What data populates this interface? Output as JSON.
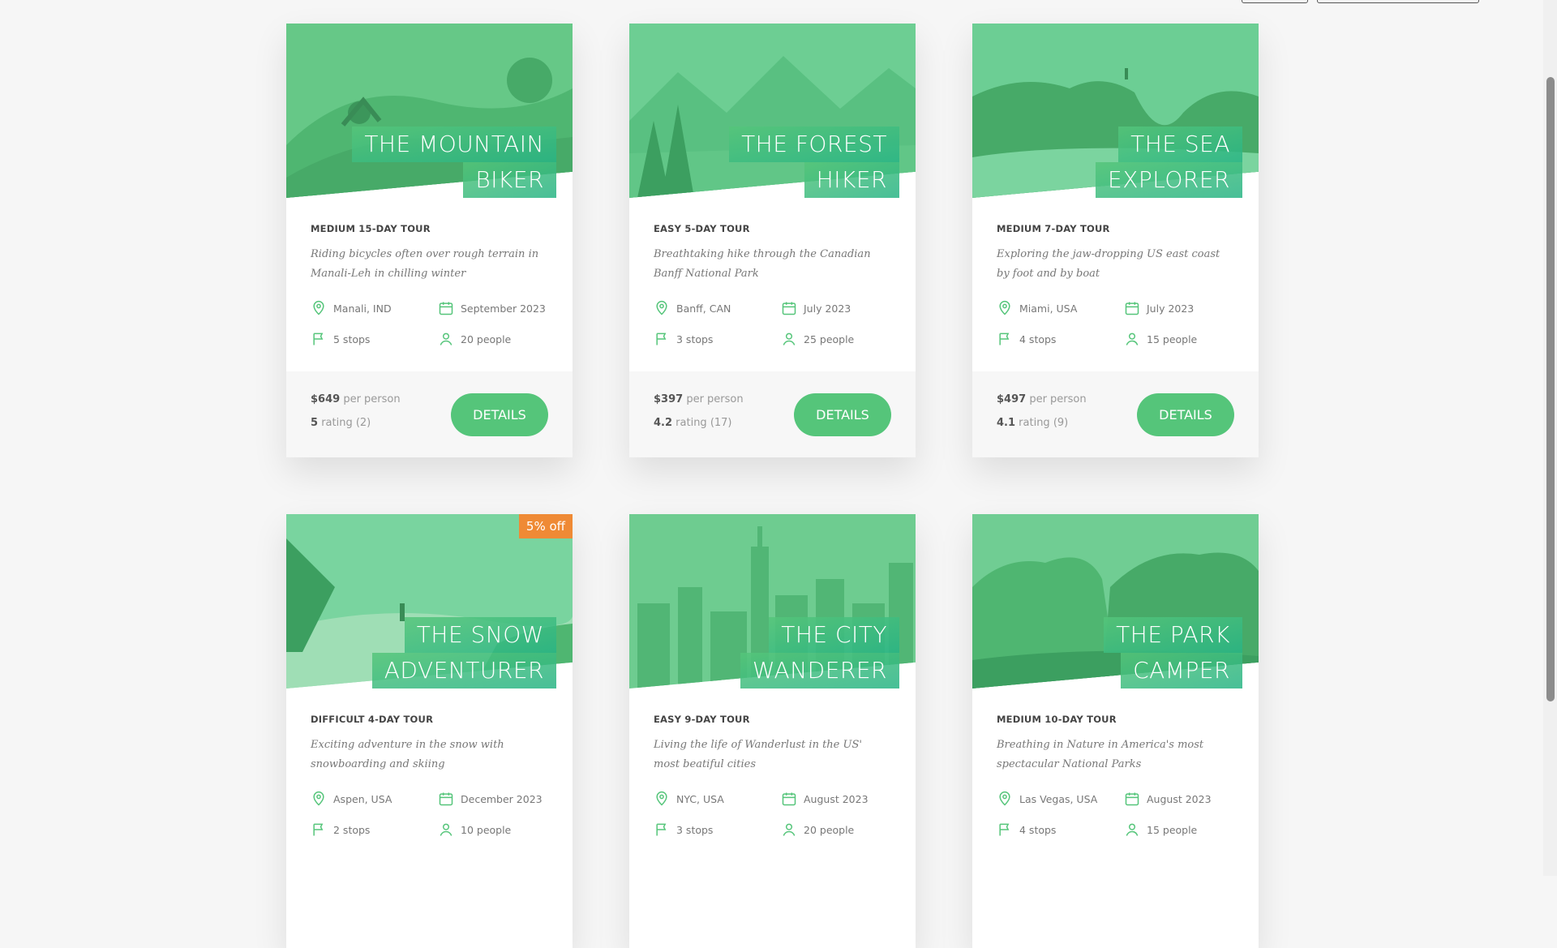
{
  "accent_color": "#55c57a",
  "badge_color": "#ef8a35",
  "icons": {
    "location": "map-pin-icon",
    "date": "calendar-icon",
    "stops": "flag-icon",
    "people": "user-icon"
  },
  "tours": [
    {
      "heading": [
        "THE MOUNTAIN",
        "BIKER"
      ],
      "subtitle": "MEDIUM 15-DAY TOUR",
      "description": "Riding bicycles often over rough terrain in Manali-Leh in chilling winter",
      "location": "Manali, IND",
      "date": "September 2023",
      "stops": "5 stops",
      "people": "20 people",
      "price": "$649",
      "price_unit": "per person",
      "rating": "5",
      "rating_label": "rating (2)",
      "button": "DETAILS",
      "badge": ""
    },
    {
      "heading": [
        "THE FOREST",
        "HIKER"
      ],
      "subtitle": "EASY 5-DAY TOUR",
      "description": "Breathtaking hike through the Canadian Banff National Park",
      "location": "Banff, CAN",
      "date": "July 2023",
      "stops": "3 stops",
      "people": "25 people",
      "price": "$397",
      "price_unit": "per person",
      "rating": "4.2",
      "rating_label": "rating (17)",
      "button": "DETAILS",
      "badge": ""
    },
    {
      "heading": [
        "THE SEA",
        "EXPLORER"
      ],
      "subtitle": "MEDIUM 7-DAY TOUR",
      "description": "Exploring the jaw-dropping US east coast by foot and by boat",
      "location": "Miami, USA",
      "date": "July 2023",
      "stops": "4 stops",
      "people": "15 people",
      "price": "$497",
      "price_unit": "per person",
      "rating": "4.1",
      "rating_label": "rating (9)",
      "button": "DETAILS",
      "badge": ""
    },
    {
      "heading": [
        "THE SNOW",
        "ADVENTURER"
      ],
      "subtitle": "DIFFICULT 4-DAY TOUR",
      "description": "Exciting adventure in the snow with snowboarding and skiing",
      "location": "Aspen, USA",
      "date": "December 2023",
      "stops": "2 stops",
      "people": "10 people",
      "price": "",
      "price_unit": "",
      "rating": "",
      "rating_label": "",
      "button": "",
      "badge": "5% off"
    },
    {
      "heading": [
        "THE CITY",
        "WANDERER"
      ],
      "subtitle": "EASY 9-DAY TOUR",
      "description": "Living the life of Wanderlust in the US' most beatiful cities",
      "location": "NYC, USA",
      "date": "August 2023",
      "stops": "3 stops",
      "people": "20 people",
      "price": "",
      "price_unit": "",
      "rating": "",
      "rating_label": "",
      "button": "",
      "badge": ""
    },
    {
      "heading": [
        "THE PARK",
        "CAMPER"
      ],
      "subtitle": "MEDIUM 10-DAY TOUR",
      "description": "Breathing in Nature in America's most spectacular National Parks",
      "location": "Las Vegas, USA",
      "date": "August 2023",
      "stops": "4 stops",
      "people": "15 people",
      "price": "",
      "price_unit": "",
      "rating": "",
      "rating_label": "",
      "button": "",
      "badge": ""
    }
  ]
}
